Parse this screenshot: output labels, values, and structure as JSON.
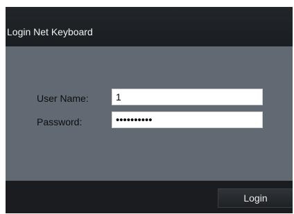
{
  "window": {
    "title": "Login Net Keyboard"
  },
  "form": {
    "username_label": "User Name:",
    "username_value": "1",
    "password_label": "Password:",
    "password_value": "1234567890"
  },
  "footer": {
    "login_label": "Login"
  },
  "colors": {
    "titlebar": "#1e2125",
    "panel": "#616a72",
    "footer": "#1a1c1f"
  }
}
